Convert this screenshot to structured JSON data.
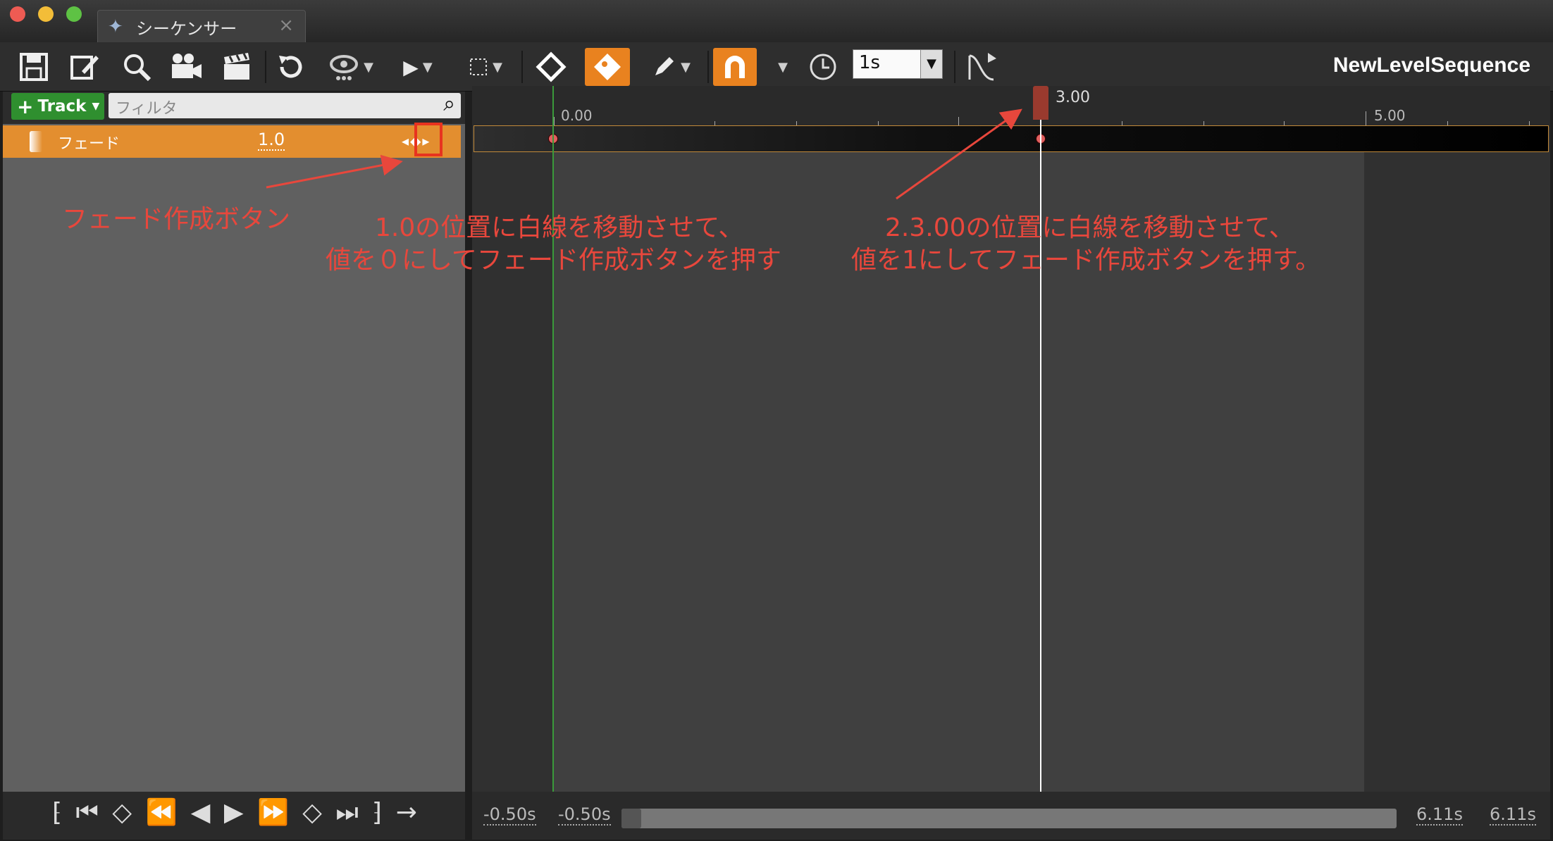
{
  "window": {
    "tab_title": "シーケンサー",
    "tab_close": "×",
    "traffic_colors": [
      "#ee5b53",
      "#f3bd38",
      "#5ec244"
    ]
  },
  "toolbar": {
    "icons": [
      "save-icon",
      "edit-icon",
      "search-icon",
      "camera-icon",
      "clapperboard-icon",
      "undo-icon",
      "eye-icon",
      "play-icon",
      "selection-icon",
      "key-diamond-icon",
      "key-tag-icon",
      "pencil-icon",
      "magnet-icon",
      "clock-icon",
      "curve-icon"
    ],
    "snap_value": "1s",
    "sequence_name": "NewLevelSequence",
    "accent": "#e9821f"
  },
  "left_panel": {
    "add_track_label": "Track",
    "filter_placeholder": "フィルタ",
    "track": {
      "label": "フェード",
      "value": "1.0",
      "nav": "◂◆▸"
    }
  },
  "timeline": {
    "ruler_labels": [
      "0.00",
      "5.00"
    ],
    "playhead_label": "3.00"
  },
  "range": {
    "start_a": "-0.50s",
    "start_b": "-0.50s",
    "end_a": "6.11s",
    "end_b": "6.11s"
  },
  "transport": {
    "glyphs": "⁅ ⏮ ◇ ⏪ ◀ ▶ ⏩ ◇ ⏭ ⁆ →"
  },
  "annotations": {
    "fade_button": "フェード作成ボタン",
    "step1_line1": "1.0の位置に白線を移動させて、",
    "step1_line2": "値を０にしてフェード作成ボタンを押す",
    "step2_line1": "2.3.00の位置に白線を移動させて、",
    "step2_line2": "値を1にしてフェード作成ボタンを押す。",
    "color": "#e8473c"
  }
}
